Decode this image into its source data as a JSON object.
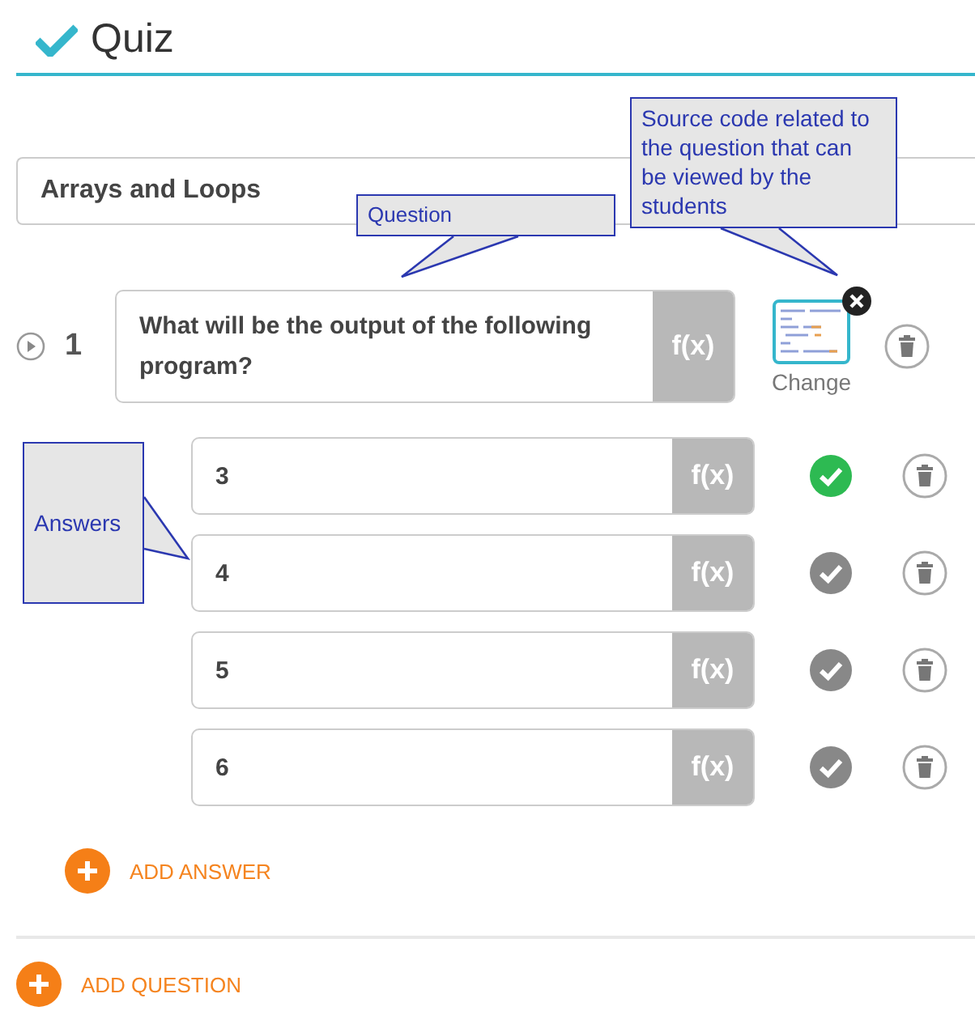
{
  "header": {
    "title": "Quiz"
  },
  "topic": {
    "value": "Arrays and Loops"
  },
  "question": {
    "number": "1",
    "text": "What will be the output of the following program?",
    "formula_button": "f(x)",
    "change_label": "Change"
  },
  "answers": [
    {
      "text": "3",
      "formula_button": "f(x)",
      "correct": true
    },
    {
      "text": "4",
      "formula_button": "f(x)",
      "correct": false
    },
    {
      "text": "5",
      "formula_button": "f(x)",
      "correct": false
    },
    {
      "text": "6",
      "formula_button": "f(x)",
      "correct": false
    }
  ],
  "add_answer": "ADD ANSWER",
  "add_question": "ADD QUESTION",
  "callouts": [
    {
      "kind": "question",
      "text": "Question"
    },
    {
      "kind": "source",
      "text": "Source code related to the question that can be viewed by the students"
    },
    {
      "kind": "answers",
      "text": "Answers"
    }
  ]
}
